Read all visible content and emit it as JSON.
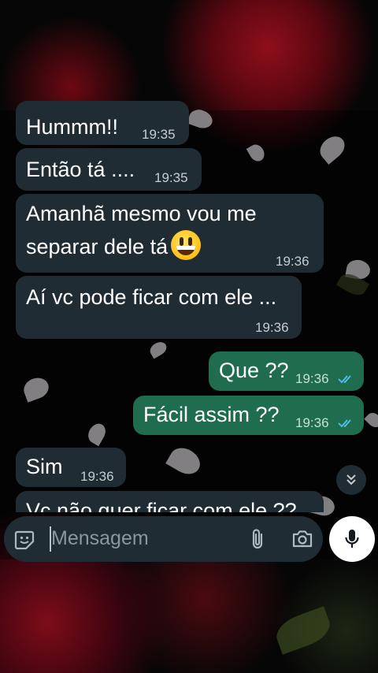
{
  "messages": [
    {
      "direction": "in",
      "text": "Hummm!!",
      "time": "19:35"
    },
    {
      "direction": "in",
      "text": "Então tá ....",
      "time": "19:35"
    },
    {
      "direction": "in",
      "line1": "Amanhã mesmo vou me",
      "line2": "separar dele tá",
      "emoji": "grinning-face-emoji",
      "time": "19:36"
    },
    {
      "direction": "in",
      "text": "Aí vc pode ficar com ele ...",
      "time": "19:36"
    },
    {
      "direction": "out",
      "text": "Que ??",
      "time": "19:36",
      "status": "read"
    },
    {
      "direction": "out",
      "text": "Fácil assim ??",
      "time": "19:36",
      "status": "read"
    },
    {
      "direction": "in",
      "text": "Sim",
      "time": "19:36"
    },
    {
      "direction": "in",
      "text": "Vc não quer ficar com ele ??",
      "partially_visible": true
    }
  ],
  "composer": {
    "placeholder": "Mensagem",
    "icons": [
      "sticker-icon",
      "attach-icon",
      "camera-icon",
      "mic-icon"
    ]
  },
  "scroll_button": {
    "icon": "double-chevron-down-icon"
  },
  "colors": {
    "incoming_bubble": "#202c33",
    "outgoing_bubble": "#1f6d4e",
    "read_ticks": "#53bdeb",
    "composer": "#1f2c33",
    "mic_button": "#ffffff"
  }
}
